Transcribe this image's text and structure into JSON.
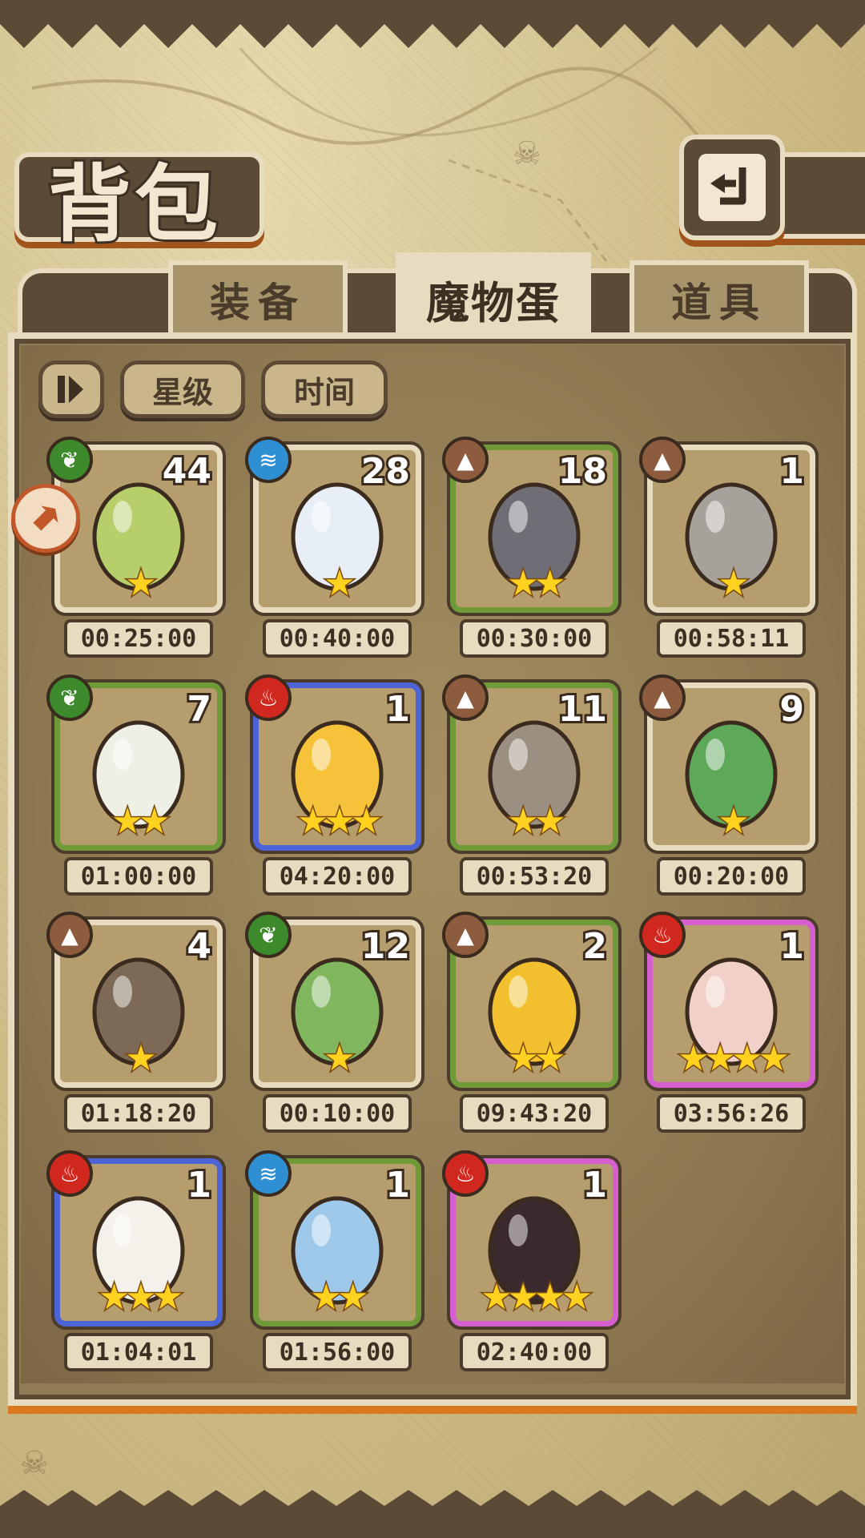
{
  "header": {
    "title": "背包",
    "back_icon": "back-arrow-icon"
  },
  "tabs": [
    {
      "label": "装备",
      "active": false
    },
    {
      "label": "魔物蛋",
      "active": true
    },
    {
      "label": "道具",
      "active": false
    }
  ],
  "sort": {
    "toggle_icon": "sort-toggle-icon",
    "star_label": "星级",
    "time_label": "时间"
  },
  "side_button_icon": "collapse-arrow-icon",
  "colors": {
    "grass": "#3d8a2c",
    "water": "#2f8fd3",
    "earth": "#8d5c3e",
    "fire": "#d0281f",
    "rarity_common": "#e7dcc0",
    "rarity_green": "#6f9a37",
    "rarity_blue": "#4d63d8",
    "rarity_purple": "#d65fd0"
  },
  "eggs": [
    {
      "element": "grass",
      "count": "44",
      "stars": 1,
      "time": "00:25:00",
      "rarity": 1,
      "egg_color": "#b6cf6a"
    },
    {
      "element": "water",
      "count": "28",
      "stars": 1,
      "time": "00:40:00",
      "rarity": 1,
      "egg_color": "#e8eef6"
    },
    {
      "element": "earth",
      "count": "18",
      "stars": 2,
      "time": "00:30:00",
      "rarity": 2,
      "egg_color": "#6f6e76"
    },
    {
      "element": "earth",
      "count": "1",
      "stars": 1,
      "time": "00:58:11",
      "rarity": 1,
      "egg_color": "#a7a19b"
    },
    {
      "element": "grass",
      "count": "7",
      "stars": 2,
      "time": "01:00:00",
      "rarity": 2,
      "egg_color": "#eef0e6"
    },
    {
      "element": "fire",
      "count": "1",
      "stars": 3,
      "time": "04:20:00",
      "rarity": 3,
      "egg_color": "#f5c23a"
    },
    {
      "element": "earth",
      "count": "11",
      "stars": 2,
      "time": "00:53:20",
      "rarity": 2,
      "egg_color": "#9a8f80"
    },
    {
      "element": "earth",
      "count": "9",
      "stars": 1,
      "time": "00:20:00",
      "rarity": 1,
      "egg_color": "#5ea85a"
    },
    {
      "element": "earth",
      "count": "4",
      "stars": 1,
      "time": "01:18:20",
      "rarity": 1,
      "egg_color": "#7c6a57"
    },
    {
      "element": "grass",
      "count": "12",
      "stars": 1,
      "time": "00:10:00",
      "rarity": 1,
      "egg_color": "#7fb65e"
    },
    {
      "element": "earth",
      "count": "2",
      "stars": 2,
      "time": "09:43:20",
      "rarity": 2,
      "egg_color": "#f2c02e"
    },
    {
      "element": "fire",
      "count": "1",
      "stars": 4,
      "time": "03:56:26",
      "rarity": 4,
      "egg_color": "#f0d0c8"
    },
    {
      "element": "fire",
      "count": "1",
      "stars": 3,
      "time": "01:04:01",
      "rarity": 3,
      "egg_color": "#f4f0ea"
    },
    {
      "element": "water",
      "count": "1",
      "stars": 2,
      "time": "01:56:00",
      "rarity": 2,
      "egg_color": "#9ec8ea"
    },
    {
      "element": "fire",
      "count": "1",
      "stars": 4,
      "time": "02:40:00",
      "rarity": 4,
      "egg_color": "#3a2a2e"
    }
  ]
}
